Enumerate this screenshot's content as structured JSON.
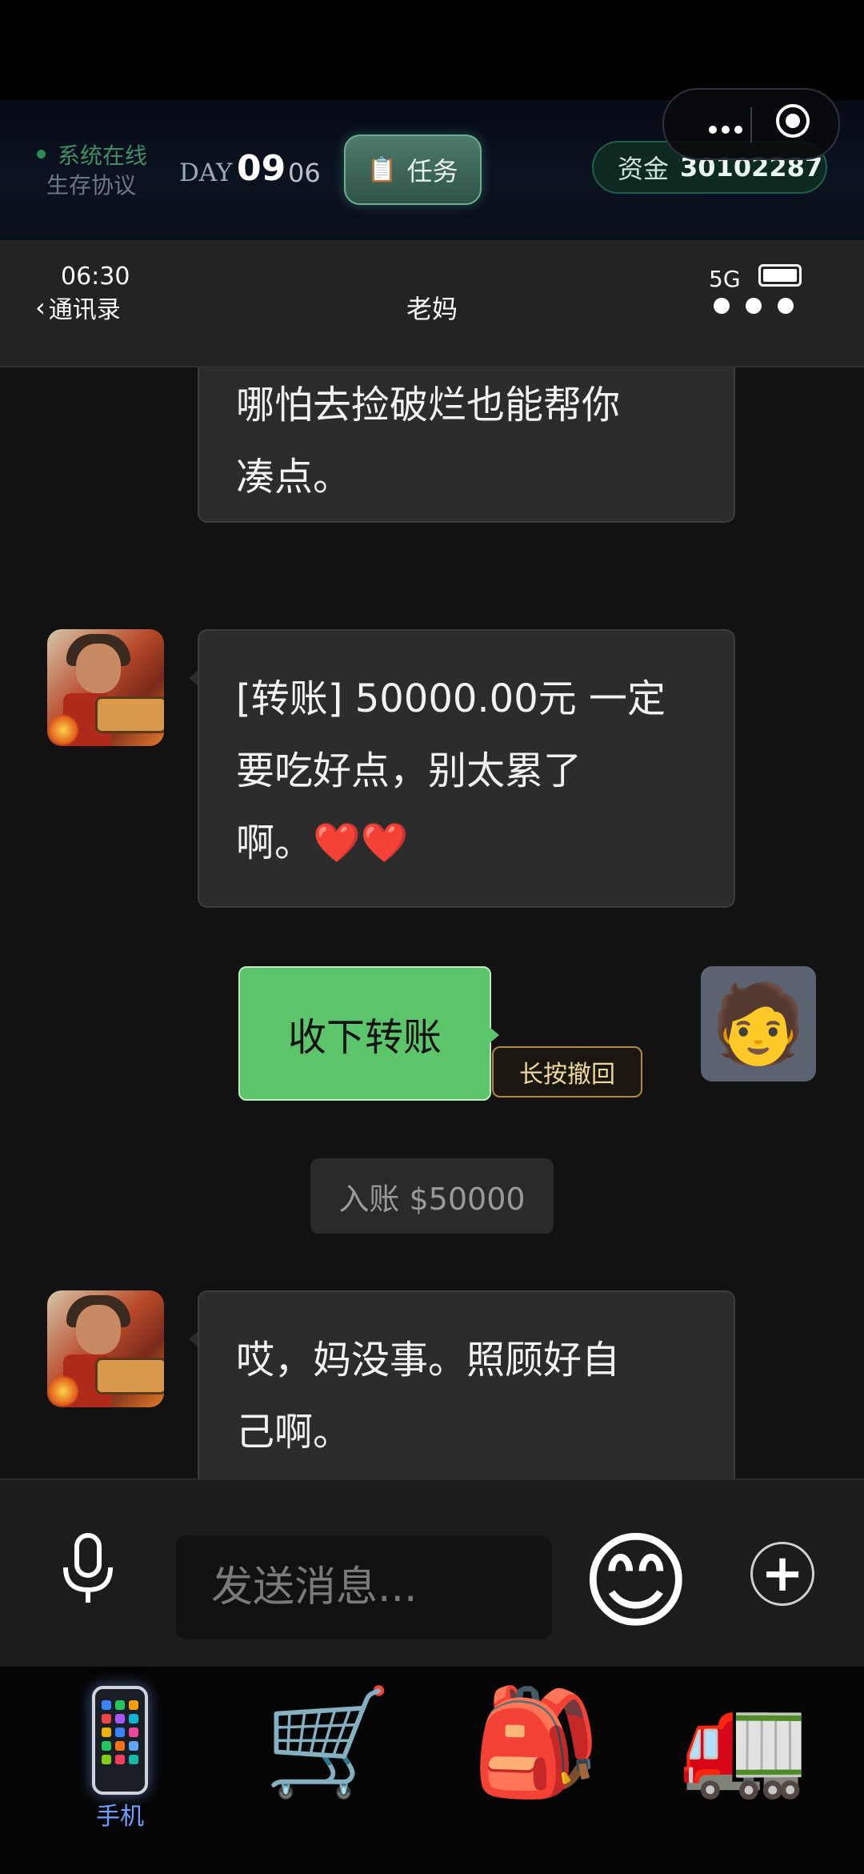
{
  "status_bar": {
    "online_text": "系统在线",
    "protocol_text": "生存协议",
    "day_label": "DAY",
    "day_number": "09",
    "day_sub": "06",
    "task_icon": "📋",
    "task_label": "任务",
    "funds_label": "资金",
    "funds_value": "30102287"
  },
  "phone_header": {
    "time": "06:30",
    "back_label": "通讯录",
    "back_chevron": "‹",
    "title": "老妈",
    "signal": "5G"
  },
  "messages": {
    "msg0_line1": "哪怕去捡破烂也能帮你",
    "msg0_line2": "凑点。",
    "msg1_line1": "[转账] 50000.00元 一定",
    "msg1_line2": "要吃好点，别太累了",
    "msg1_line3": "啊。❤️❤️",
    "accept_label": "收下转账",
    "revoke_label": "长按撤回",
    "system_notice": "入账 $50000",
    "msg2_line1": "哎，妈没事。照顾好自",
    "msg2_line2": "己啊。",
    "me_avatar": "🧑"
  },
  "input": {
    "placeholder": "发送消息...",
    "emoji": "😊",
    "plus": "+"
  },
  "bottom_nav": {
    "phone_label": "手机",
    "cart_icon": "🛒",
    "backpack_icon": "🎒",
    "truck_icon": "🚛"
  },
  "colors": {
    "accent_green": "#5cc56c",
    "nav_active": "#6fa0ff",
    "online_green": "#3f8e66"
  }
}
